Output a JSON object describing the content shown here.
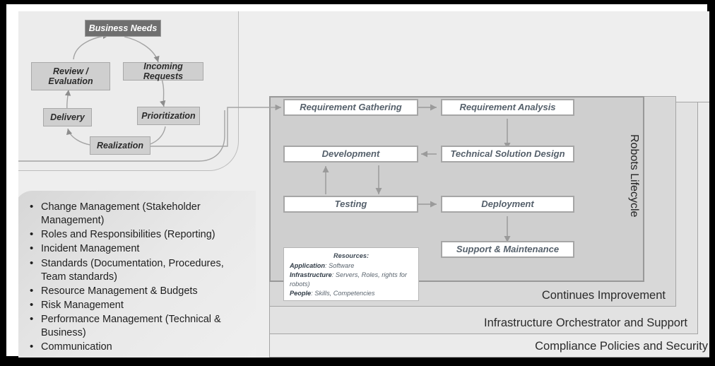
{
  "diagram": {
    "title": "Robots Lifecycle Governance Diagram",
    "colors": {
      "dark_node": "#6f6f6f",
      "grey_node": "#cfcfcf",
      "white_node": "#ffffff",
      "border": "#a5a5a5",
      "canvas": "#eeeeee"
    }
  },
  "demand_cycle": {
    "nodes": [
      {
        "id": "business-needs",
        "label": "Business Needs",
        "style": "dark"
      },
      {
        "id": "incoming-requests",
        "label": "Incoming Requests",
        "style": "grey"
      },
      {
        "id": "review-evaluation",
        "label": "Review /\nEvaluation",
        "style": "grey"
      },
      {
        "id": "prioritization",
        "label": "Prioritization",
        "style": "grey"
      },
      {
        "id": "delivery",
        "label": "Delivery",
        "style": "grey"
      },
      {
        "id": "realization",
        "label": "Realization",
        "style": "grey"
      }
    ]
  },
  "governance_list": {
    "items": [
      "Change Management (Stakeholder Management)",
      "Roles and Responsibilities (Reporting)",
      "Incident Management",
      "Standards (Documentation, Procedures, Team standards)",
      "Resource Management & Budgets",
      "Risk Management",
      "Performance Management (Technical & Business)",
      "Communication"
    ]
  },
  "lifecycle": {
    "vertical_label": "Robots Lifecycle",
    "nodes": [
      {
        "id": "requirement-gathering",
        "label": "Requirement Gathering"
      },
      {
        "id": "requirement-analysis",
        "label": "Requirement Analysis"
      },
      {
        "id": "technical-solution-design",
        "label": "Technical Solution Design"
      },
      {
        "id": "development",
        "label": "Development"
      },
      {
        "id": "testing",
        "label": "Testing"
      },
      {
        "id": "deployment",
        "label": "Deployment"
      },
      {
        "id": "support-maintenance",
        "label": "Support & Maintenance"
      }
    ]
  },
  "bands": [
    {
      "id": "continues-improvement",
      "label": "Continues Improvement"
    },
    {
      "id": "infrastructure-orchestrator",
      "label": "Infrastructure Orchestrator and Support"
    },
    {
      "id": "compliance-policies",
      "label": "Compliance Policies and Security"
    }
  ],
  "resources": {
    "title": "Resources:",
    "rows": [
      {
        "key": "Application",
        "value": ": Software"
      },
      {
        "key": "Infrastructure",
        "value": ": Servers, Roles, rights for robots)"
      },
      {
        "key": "People",
        "value": ": Skills, Competencies"
      }
    ]
  }
}
